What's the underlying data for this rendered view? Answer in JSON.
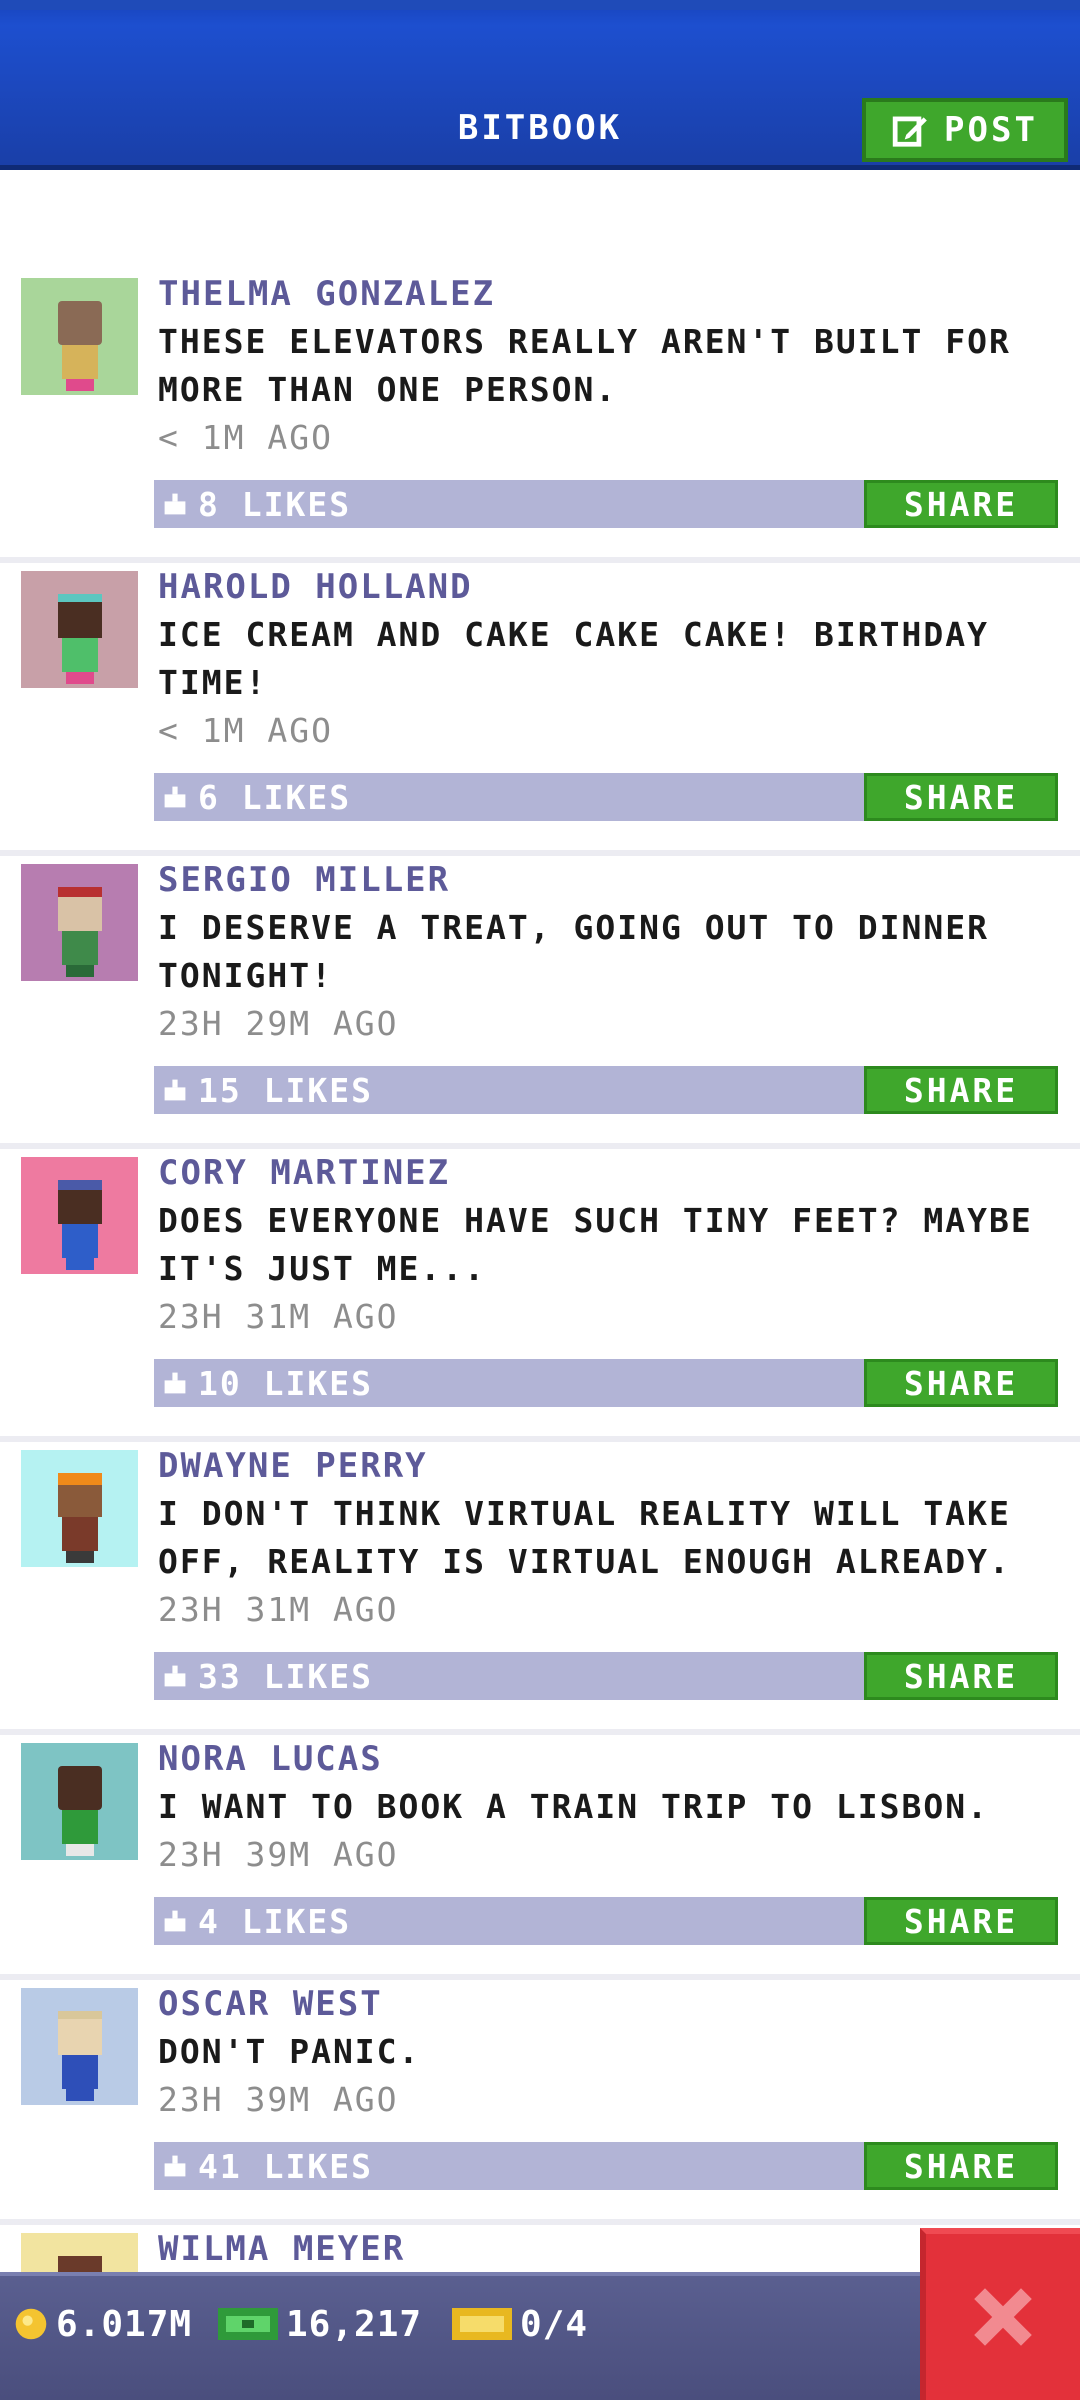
{
  "header": {
    "title": "BITBOOK",
    "post_label": "POST"
  },
  "posts": [
    {
      "name": "THELMA GONZALEZ",
      "message": "THESE ELEVATORS REALLY AREN'T BUILT FOR MORE THAN ONE PERSON.",
      "time": "< 1M AGO",
      "likes": "8 LIKES",
      "share": "SHARE",
      "avatar_bg": "#a9d69a"
    },
    {
      "name": "HAROLD HOLLAND",
      "message": "ICE CREAM AND CAKE CAKE CAKE! BIRTHDAY TIME!",
      "time": "< 1M AGO",
      "likes": "6 LIKES",
      "share": "SHARE",
      "avatar_bg": "#c8a0a8"
    },
    {
      "name": "SERGIO MILLER",
      "message": "I DESERVE A TREAT, GOING OUT TO DINNER TONIGHT!",
      "time": "23H 29M AGO",
      "likes": "15 LIKES",
      "share": "SHARE",
      "avatar_bg": "#b77db0"
    },
    {
      "name": "CORY MARTINEZ",
      "message": "DOES EVERYONE HAVE SUCH TINY FEET? MAYBE IT'S JUST ME...",
      "time": "23H 31M AGO",
      "likes": "10 LIKES",
      "share": "SHARE",
      "avatar_bg": "#ee7aa0"
    },
    {
      "name": "DWAYNE PERRY",
      "message": "I DON'T THINK VIRTUAL REALITY WILL TAKE OFF, REALITY IS VIRTUAL ENOUGH ALREADY.",
      "time": "23H 31M AGO",
      "likes": "33 LIKES",
      "share": "SHARE",
      "avatar_bg": "#b5f2f2"
    },
    {
      "name": "NORA LUCAS",
      "message": "I WANT TO BOOK A TRAIN TRIP TO LISBON.",
      "time": "23H 39M AGO",
      "likes": "4 LIKES",
      "share": "SHARE",
      "avatar_bg": "#7ec4c4"
    },
    {
      "name": "OSCAR WEST",
      "message": "DON'T PANIC.",
      "time": "23H 39M AGO",
      "likes": "41 LIKES",
      "share": "SHARE",
      "avatar_bg": "#b9cbe6"
    },
    {
      "name": "WILMA MEYER",
      "message": "",
      "time": "",
      "likes": "",
      "share": "",
      "avatar_bg": "#f2e4a0"
    }
  ],
  "footer": {
    "coins": "6.017M",
    "bux": "16,217",
    "tickets": "0/4"
  },
  "colors": {
    "accent_green": "#3fa72c",
    "header_blue": "#1d4fcf",
    "close_red": "#e3313a"
  }
}
